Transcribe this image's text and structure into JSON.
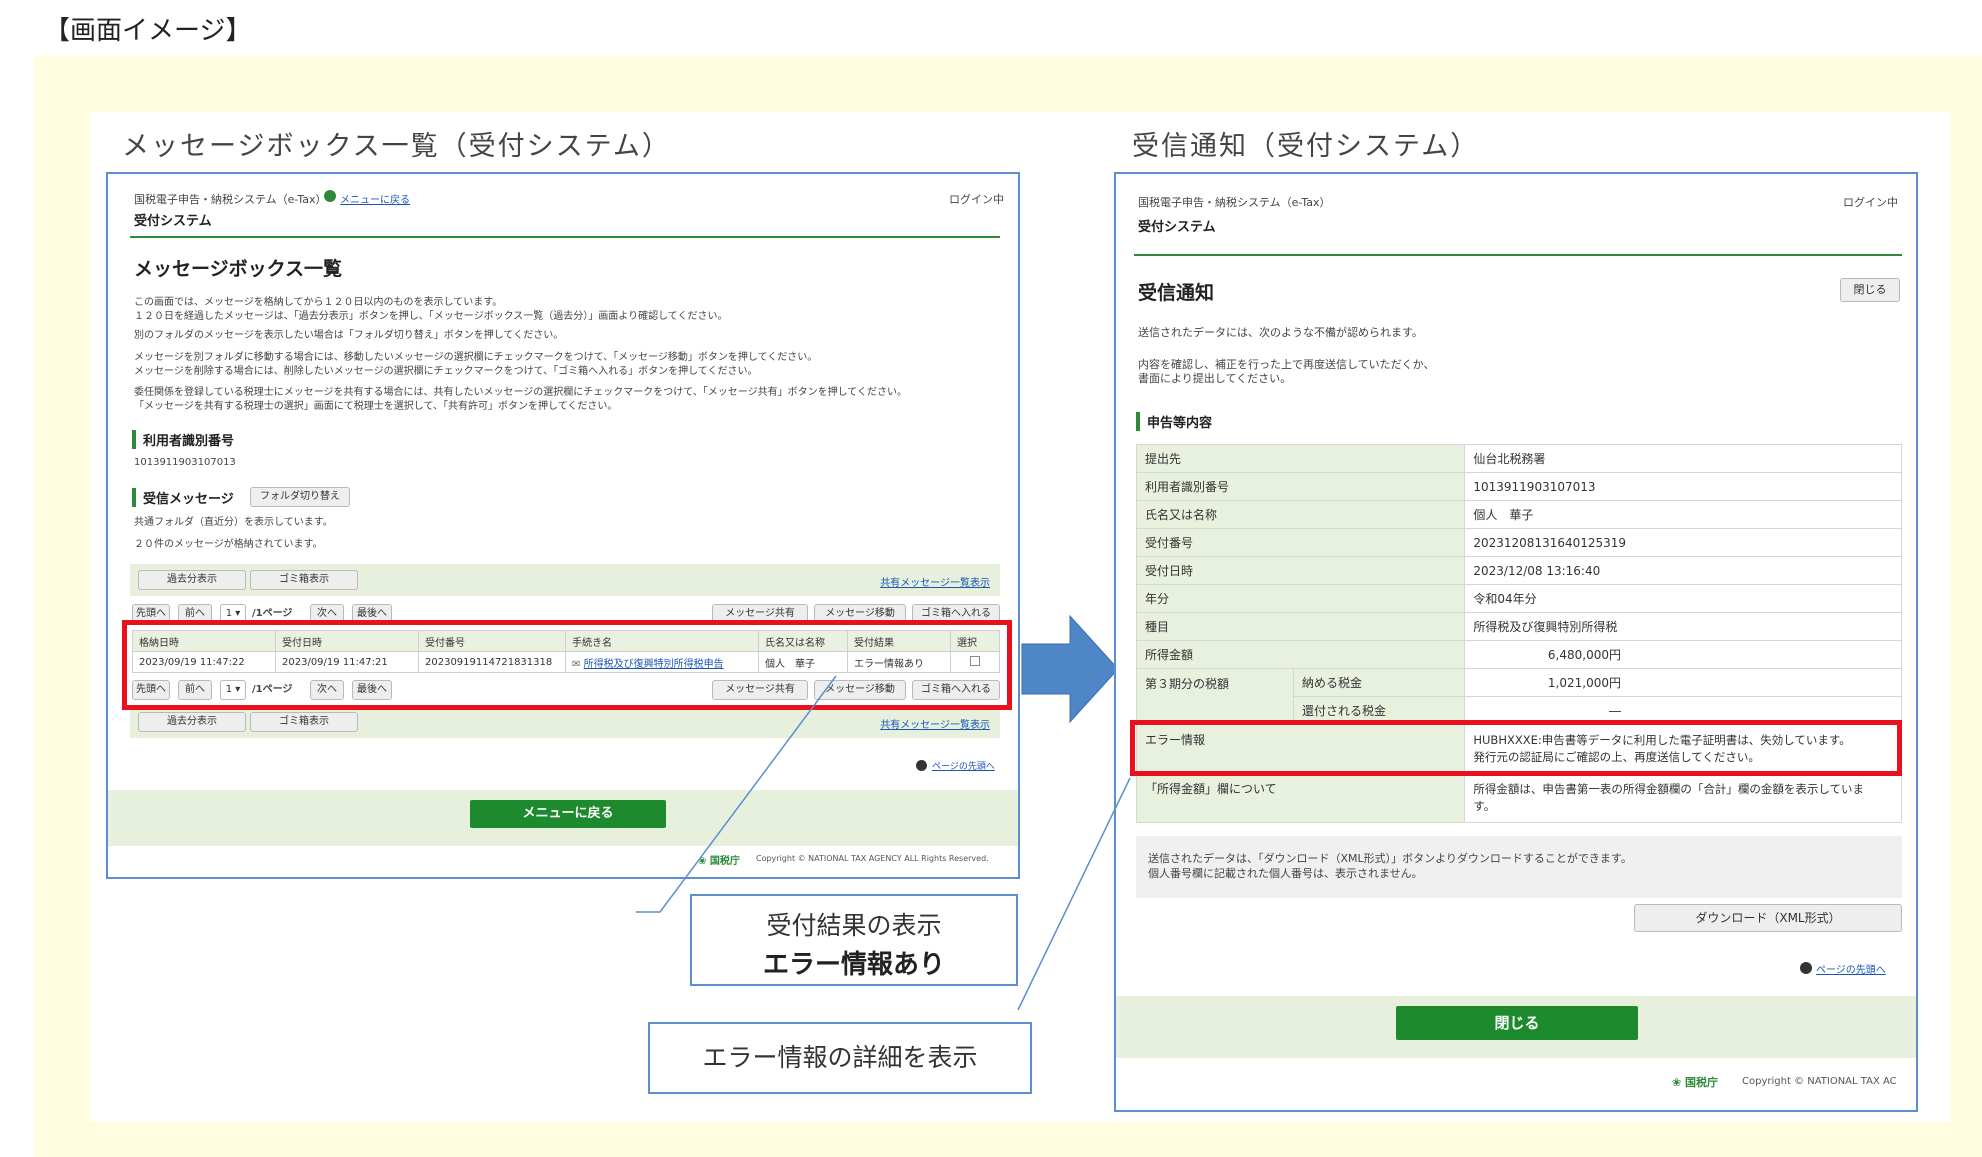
{
  "heading": "【画面イメージ】",
  "left": {
    "title": "メッセージボックス一覧（受付システム）",
    "sys_name": "国税電子申告・納税システム（e-Tax）",
    "back_menu_link": "メニューに戻る",
    "login_status": "ログイン中",
    "sys_title": "受付システム",
    "page_title": "メッセージボックス一覧",
    "desc": [
      "この画面では、メッセージを格納してから１２０日以内のものを表示しています。",
      "１２０日を経過したメッセージは、「過去分表示」ボタンを押し、「メッセージボックス一覧（過去分）」画面より確認してください。",
      "別のフォルダのメッセージを表示したい場合は「フォルダ切り替え」ボタンを押してください。",
      "メッセージを別フォルダに移動する場合には、移動したいメッセージの選択欄にチェックマークをつけて、「メッセージ移動」ボタンを押してください。",
      "メッセージを削除する場合には、削除したいメッセージの選択欄にチェックマークをつけて、「ゴミ箱へ入れる」ボタンを押してください。",
      "委任関係を登録している税理士にメッセージを共有する場合には、共有したいメッセージの選択欄にチェックマークをつけて、「メッセージ共有」ボタンを押してください。",
      "「メッセージを共有する税理士の選択」画面にて税理士を選択して、「共有許可」ボタンを押してください。"
    ],
    "user_id_label": "利用者識別番号",
    "user_id": "1013911903107013",
    "recv_label": "受信メッセージ",
    "folder_switch_btn": "フォルダ切り替え",
    "folder_note": "共通フォルダ（直近分）を表示しています。",
    "count_note": "２０件のメッセージが格納されています。",
    "past_btn": "過去分表示",
    "trash_btn": "ゴミ箱表示",
    "shared_link": "共有メッセージ一覧表示",
    "pager": {
      "first": "先頭へ",
      "prev": "前へ",
      "page_sel": "1",
      "total": "/1ページ",
      "next": "次へ",
      "last": "最後へ"
    },
    "share_btn": "メッセージ共有",
    "move_btn": "メッセージ移動",
    "trash_put_btn": "ゴミ箱へ入れる",
    "table": {
      "headers": [
        "格納日時",
        "受付日時",
        "受付番号",
        "手続き名",
        "氏名又は名称",
        "受付結果",
        "選択"
      ],
      "row": [
        "2023/09/19 11:47:22",
        "2023/09/19 11:47:21",
        "20230919114721831318",
        "所得税及び復興特別所得税申告",
        "個人　華子",
        "エラー情報あり",
        ""
      ]
    },
    "page_top_link": "ページの先頭へ",
    "menu_btn": "メニューに戻る",
    "nta": "国税庁",
    "copyright": "Copyright © NATIONAL TAX AGENCY ALL Rights Reserved."
  },
  "right": {
    "title": "受信通知（受付システム）",
    "sys_name": "国税電子申告・納税システム（e-Tax）",
    "login_status": "ログイン中",
    "sys_title": "受付システム",
    "page_title": "受信通知",
    "close_btn": "閉じる",
    "desc1": "送信されたデータには、次のような不備が認められます。",
    "desc2": "内容を確認し、補正を行った上で再度送信していただくか、",
    "desc3": "書面により提出してください。",
    "section": "申告等内容",
    "rows": [
      {
        "k": "提出先",
        "v": "仙台北税務署"
      },
      {
        "k": "利用者識別番号",
        "v": "1013911903107013"
      },
      {
        "k": "氏名又は名称",
        "v": "個人　華子"
      },
      {
        "k": "受付番号",
        "v": "20231208131640125319"
      },
      {
        "k": "受付日時",
        "v": "2023/12/08 13:16:40"
      },
      {
        "k": "年分",
        "v": "令和04年分"
      },
      {
        "k": "種目",
        "v": "所得税及び復興特別所得税"
      }
    ],
    "income_label": "所得金額",
    "income_value": "6,480,000円",
    "tax3_label": "第３期分の税額",
    "pay_label": "納める税金",
    "pay_value": "1,021,000円",
    "refund_label": "還付される税金",
    "refund_value": "―",
    "error_label": "エラー情報",
    "error_line1": "HUBHXXXE:申告書等データに利用した電子証明書は、失効しています。",
    "error_line2": "発行元の認証局にご確認の上、再度送信してください。",
    "note_label": "「所得金額」欄について",
    "note_line1": "所得金額は、申告書第一表の所得金額欄の「合計」欄の金額を表示していま",
    "note_line2": "す。",
    "dl_note1": "送信されたデータは、「ダウンロード（XML形式）」ボタンよりダウンロードすることができます。",
    "dl_note2": "個人番号欄に記載された個人番号は、表示されません。",
    "dl_btn": "ダウンロード（XML形式）",
    "page_top_link": "ページの先頭へ",
    "close_btn2": "閉じる",
    "nta": "国税庁",
    "copyright": "Copyright © NATIONAL TAX AC"
  },
  "callout1": {
    "line1": "受付結果の表示",
    "line2": "エラー情報あり"
  },
  "callout2": "エラー情報の詳細を表示",
  "colors": {
    "accent_green": "#2d8a3a",
    "highlight_red": "#e8101c",
    "frame_blue": "#5b8fd0",
    "arrow_blue": "#4f86c8"
  }
}
